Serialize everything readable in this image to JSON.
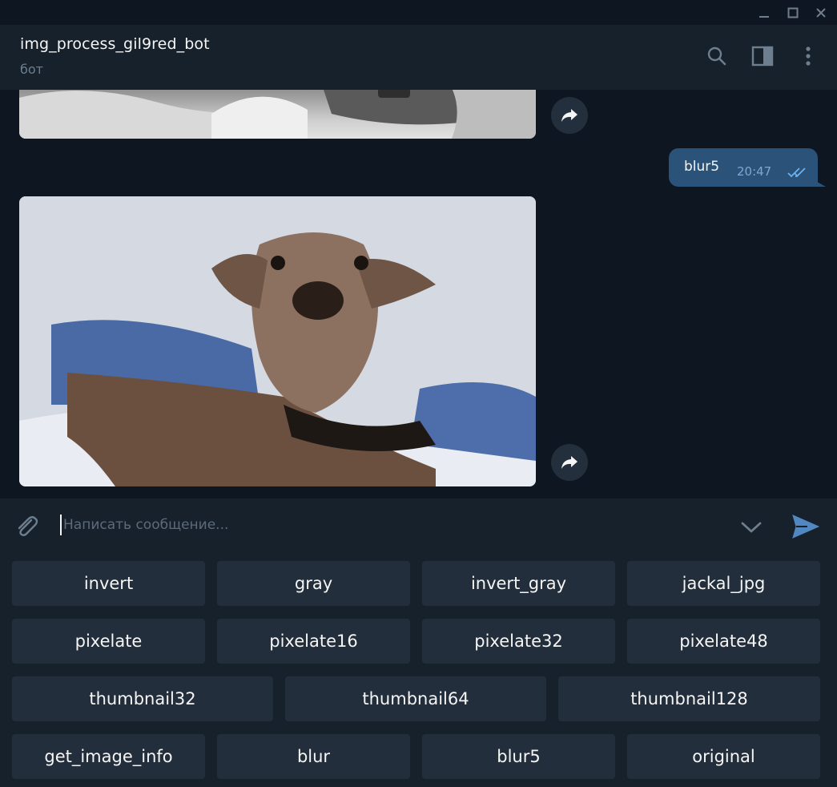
{
  "chat": {
    "title": "img_process_gil9red_bot",
    "subtitle": "бот"
  },
  "message": {
    "text": "blur5",
    "time": "20:47"
  },
  "input": {
    "placeholder": "Написать сообщение...",
    "value": ""
  },
  "keyboard": {
    "row1": [
      "invert",
      "gray",
      "invert_gray",
      "jackal_jpg"
    ],
    "row2": [
      "pixelate",
      "pixelate16",
      "pixelate32",
      "pixelate48"
    ],
    "row3": [
      "thumbnail32",
      "thumbnail64",
      "thumbnail128"
    ],
    "row4": [
      "get_image_info",
      "blur",
      "blur5",
      "original"
    ]
  },
  "icons": {
    "minimize": "minimize-icon",
    "maximize": "maximize-icon",
    "close": "close-icon",
    "search": "search-icon",
    "sidebar": "sidebar-panel-icon",
    "more": "more-vertical-icon",
    "forward": "forward-icon",
    "read": "double-check-icon",
    "attach": "paperclip-icon",
    "chevron": "chevron-down-icon",
    "send": "send-icon"
  },
  "colors": {
    "background": "#0e1621",
    "panel": "#17212b",
    "outgoing_bubble": "#2b5278",
    "button": "#232e3c",
    "accent": "#5288c1"
  }
}
